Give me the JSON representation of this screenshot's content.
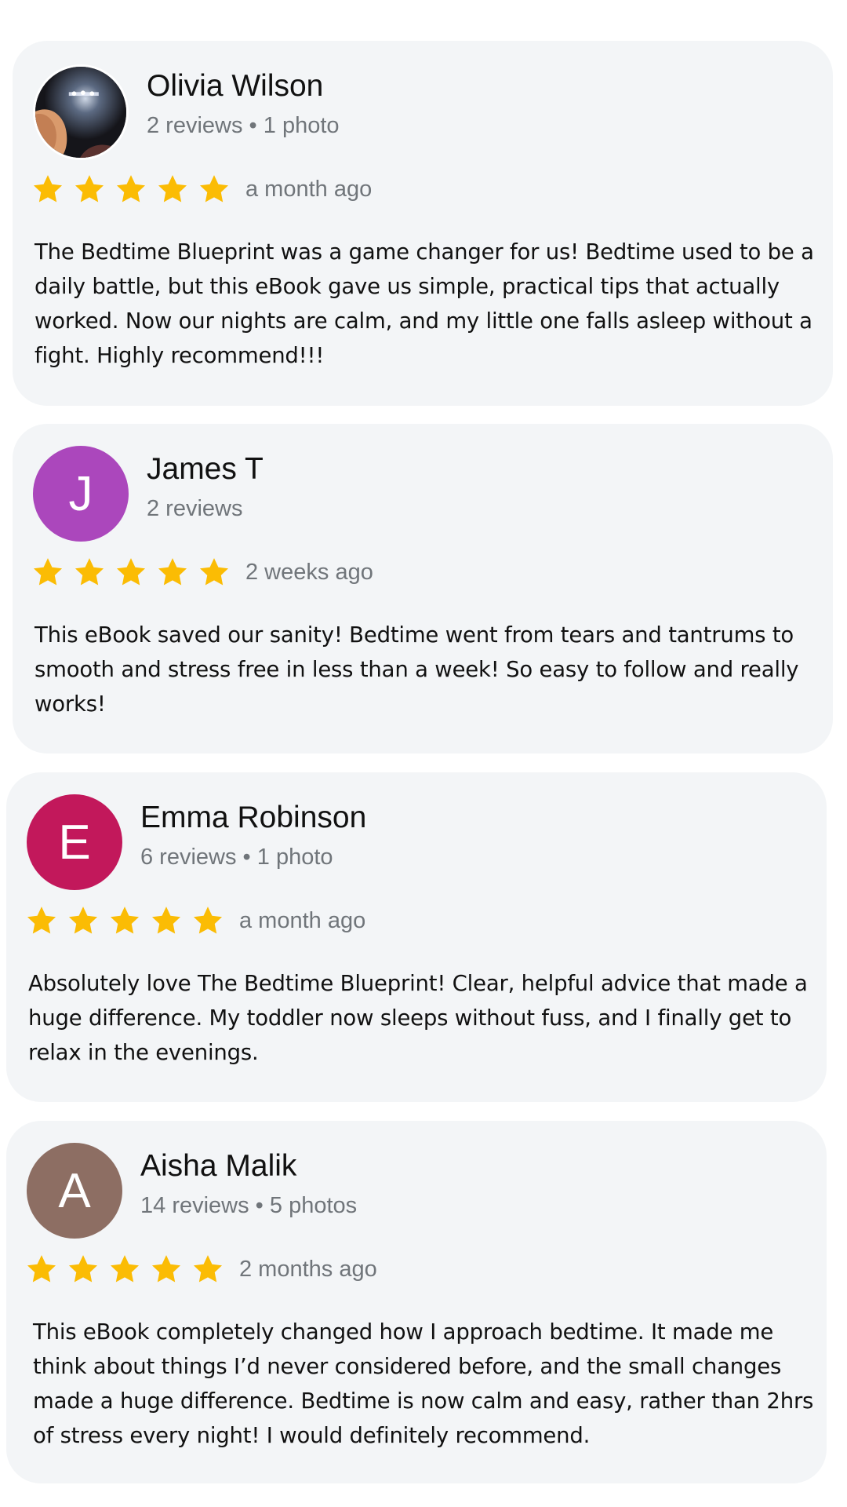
{
  "reviews": [
    {
      "name": "Olivia Wilson",
      "meta": "2 reviews • 1 photo",
      "avatar": {
        "type": "photo",
        "icon": "profile-photo"
      },
      "rating": 5,
      "time": "a month ago",
      "text": "The Bedtime Blueprint was a game changer for us! Bedtime used to be a daily battle, but this eBook gave us simple, practical tips that actually worked. Now our nights are calm, and my little one falls asleep without a fight. Highly recommend!!!"
    },
    {
      "name": "James T",
      "meta": "2 reviews",
      "avatar": {
        "type": "letter",
        "letter": "J",
        "color": "#ab47bc"
      },
      "rating": 5,
      "time": "2 weeks ago",
      "text": "This eBook saved our sanity! Bedtime went from tears and tantrums to smooth and stress free in less than a week! So easy to follow and really works!"
    },
    {
      "name": "Emma Robinson",
      "meta": "6 reviews • 1 photo",
      "avatar": {
        "type": "letter",
        "letter": "E",
        "color": "#c2185b"
      },
      "rating": 5,
      "time": "a month ago",
      "text": "Absolutely love The Bedtime Blueprint! Clear, helpful advice that made a huge difference. My toddler now sleeps without fuss, and I finally get to relax in the evenings."
    },
    {
      "name": "Aisha Malik",
      "meta": "14 reviews • 5 photos",
      "avatar": {
        "type": "letter",
        "letter": "A",
        "color": "#8d6e63"
      },
      "rating": 5,
      "time": "2 months ago",
      "text": "This eBook completely changed how I approach bedtime. It made me think about things I’d never considered before, and the small changes made a huge difference. Bedtime is now calm and easy, rather than 2hrs of stress every night! I would definitely recommend."
    }
  ],
  "colors": {
    "star": "#fbbc04",
    "card_bg": "#f3f5f7",
    "meta_text": "#70757a",
    "body_text": "#111111"
  },
  "icons": {
    "star": "star-icon"
  }
}
